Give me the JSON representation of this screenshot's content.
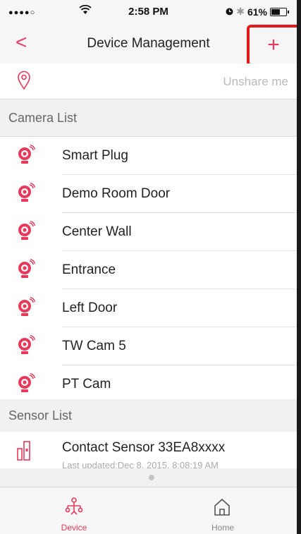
{
  "status_bar": {
    "signal": "●●●●○",
    "wifi_icon": "wifi-icon",
    "time": "2:58 PM",
    "bluetooth": "✱",
    "battery": "61%"
  },
  "navbar": {
    "back": "<",
    "title": "Device Management",
    "add": "+"
  },
  "share_row": {
    "icon": "location-pin-icon",
    "unshare_label": "Unshare me"
  },
  "camera_section": {
    "header": "Camera List",
    "cameras": [
      {
        "name": "Smart Plug"
      },
      {
        "name": "Demo Room Door"
      },
      {
        "name": "Center Wall"
      },
      {
        "name": "Entrance"
      },
      {
        "name": "Left Door"
      },
      {
        "name": "TW Cam 5"
      },
      {
        "name": "PT Cam"
      }
    ]
  },
  "sensor_section": {
    "header": "Sensor List",
    "sensors": [
      {
        "name": "Contact Sensor 33EA8xxxx",
        "updated": "Last updated:Dec 8, 2015, 8:08:19 AM"
      }
    ]
  },
  "tabbar": {
    "device_label": "Device",
    "home_label": "Home"
  },
  "colors": {
    "accent": "#e8395a",
    "highlight_box": "#e21a1a"
  }
}
